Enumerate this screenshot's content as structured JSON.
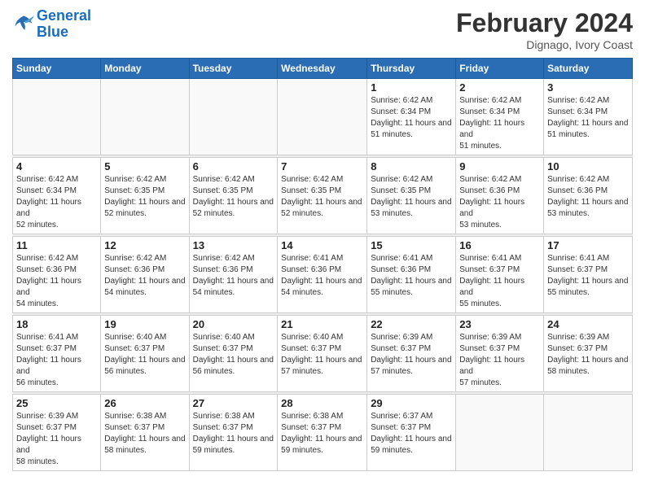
{
  "header": {
    "logo_general": "General",
    "logo_blue": "Blue",
    "title": "February 2024",
    "subtitle": "Dignago, Ivory Coast"
  },
  "calendar": {
    "days_of_week": [
      "Sunday",
      "Monday",
      "Tuesday",
      "Wednesday",
      "Thursday",
      "Friday",
      "Saturday"
    ],
    "weeks": [
      [
        {
          "day": "",
          "info": ""
        },
        {
          "day": "",
          "info": ""
        },
        {
          "day": "",
          "info": ""
        },
        {
          "day": "",
          "info": ""
        },
        {
          "day": "1",
          "info": "Sunrise: 6:42 AM\nSunset: 6:34 PM\nDaylight: 11 hours and 51 minutes."
        },
        {
          "day": "2",
          "info": "Sunrise: 6:42 AM\nSunset: 6:34 PM\nDaylight: 11 hours and 51 minutes."
        },
        {
          "day": "3",
          "info": "Sunrise: 6:42 AM\nSunset: 6:34 PM\nDaylight: 11 hours and 51 minutes."
        }
      ],
      [
        {
          "day": "4",
          "info": "Sunrise: 6:42 AM\nSunset: 6:34 PM\nDaylight: 11 hours and 52 minutes."
        },
        {
          "day": "5",
          "info": "Sunrise: 6:42 AM\nSunset: 6:35 PM\nDaylight: 11 hours and 52 minutes."
        },
        {
          "day": "6",
          "info": "Sunrise: 6:42 AM\nSunset: 6:35 PM\nDaylight: 11 hours and 52 minutes."
        },
        {
          "day": "7",
          "info": "Sunrise: 6:42 AM\nSunset: 6:35 PM\nDaylight: 11 hours and 52 minutes."
        },
        {
          "day": "8",
          "info": "Sunrise: 6:42 AM\nSunset: 6:35 PM\nDaylight: 11 hours and 53 minutes."
        },
        {
          "day": "9",
          "info": "Sunrise: 6:42 AM\nSunset: 6:36 PM\nDaylight: 11 hours and 53 minutes."
        },
        {
          "day": "10",
          "info": "Sunrise: 6:42 AM\nSunset: 6:36 PM\nDaylight: 11 hours and 53 minutes."
        }
      ],
      [
        {
          "day": "11",
          "info": "Sunrise: 6:42 AM\nSunset: 6:36 PM\nDaylight: 11 hours and 54 minutes."
        },
        {
          "day": "12",
          "info": "Sunrise: 6:42 AM\nSunset: 6:36 PM\nDaylight: 11 hours and 54 minutes."
        },
        {
          "day": "13",
          "info": "Sunrise: 6:42 AM\nSunset: 6:36 PM\nDaylight: 11 hours and 54 minutes."
        },
        {
          "day": "14",
          "info": "Sunrise: 6:41 AM\nSunset: 6:36 PM\nDaylight: 11 hours and 54 minutes."
        },
        {
          "day": "15",
          "info": "Sunrise: 6:41 AM\nSunset: 6:36 PM\nDaylight: 11 hours and 55 minutes."
        },
        {
          "day": "16",
          "info": "Sunrise: 6:41 AM\nSunset: 6:37 PM\nDaylight: 11 hours and 55 minutes."
        },
        {
          "day": "17",
          "info": "Sunrise: 6:41 AM\nSunset: 6:37 PM\nDaylight: 11 hours and 55 minutes."
        }
      ],
      [
        {
          "day": "18",
          "info": "Sunrise: 6:41 AM\nSunset: 6:37 PM\nDaylight: 11 hours and 56 minutes."
        },
        {
          "day": "19",
          "info": "Sunrise: 6:40 AM\nSunset: 6:37 PM\nDaylight: 11 hours and 56 minutes."
        },
        {
          "day": "20",
          "info": "Sunrise: 6:40 AM\nSunset: 6:37 PM\nDaylight: 11 hours and 56 minutes."
        },
        {
          "day": "21",
          "info": "Sunrise: 6:40 AM\nSunset: 6:37 PM\nDaylight: 11 hours and 57 minutes."
        },
        {
          "day": "22",
          "info": "Sunrise: 6:39 AM\nSunset: 6:37 PM\nDaylight: 11 hours and 57 minutes."
        },
        {
          "day": "23",
          "info": "Sunrise: 6:39 AM\nSunset: 6:37 PM\nDaylight: 11 hours and 57 minutes."
        },
        {
          "day": "24",
          "info": "Sunrise: 6:39 AM\nSunset: 6:37 PM\nDaylight: 11 hours and 58 minutes."
        }
      ],
      [
        {
          "day": "25",
          "info": "Sunrise: 6:39 AM\nSunset: 6:37 PM\nDaylight: 11 hours and 58 minutes."
        },
        {
          "day": "26",
          "info": "Sunrise: 6:38 AM\nSunset: 6:37 PM\nDaylight: 11 hours and 58 minutes."
        },
        {
          "day": "27",
          "info": "Sunrise: 6:38 AM\nSunset: 6:37 PM\nDaylight: 11 hours and 59 minutes."
        },
        {
          "day": "28",
          "info": "Sunrise: 6:38 AM\nSunset: 6:37 PM\nDaylight: 11 hours and 59 minutes."
        },
        {
          "day": "29",
          "info": "Sunrise: 6:37 AM\nSunset: 6:37 PM\nDaylight: 11 hours and 59 minutes."
        },
        {
          "day": "",
          "info": ""
        },
        {
          "day": "",
          "info": ""
        }
      ]
    ]
  }
}
